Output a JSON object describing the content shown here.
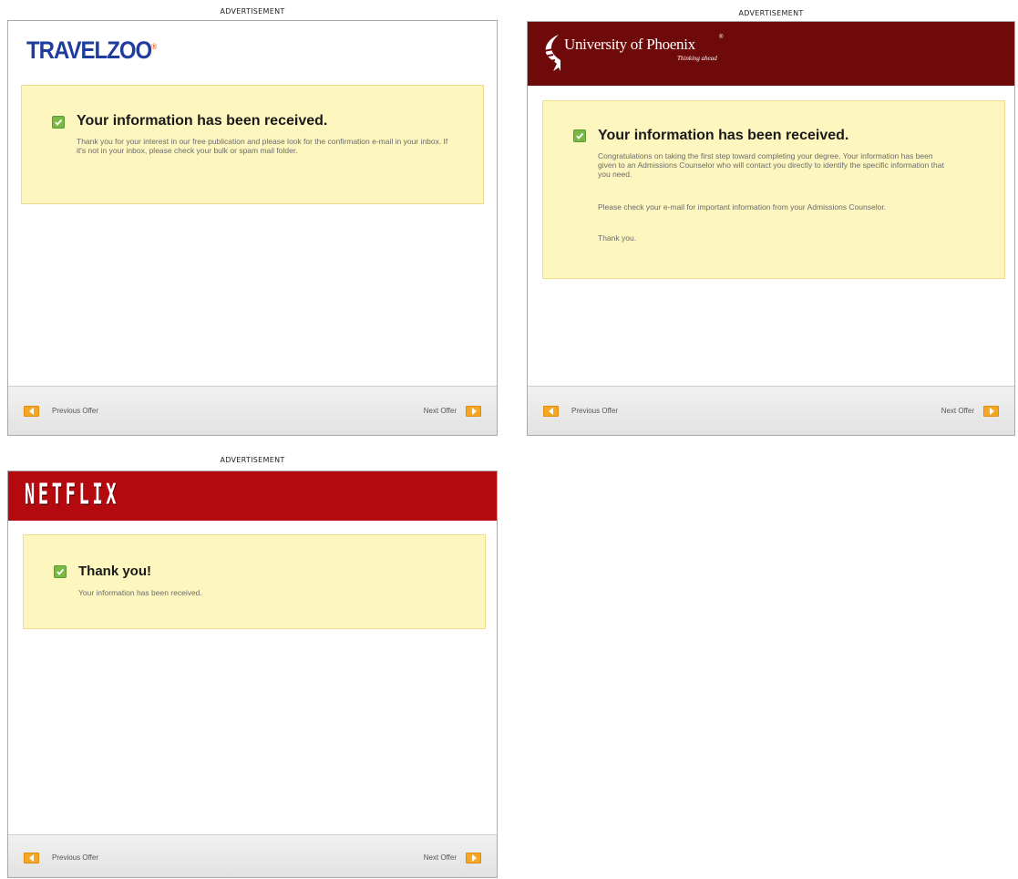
{
  "ads": {
    "travelzoo": {
      "caption": "ADVERTISEMENT",
      "brand": "TRAVELZOO",
      "brand_mark": "®",
      "heading": "Your information has been received.",
      "body": "Thank you for your interest in our free publication and please look for the confirmation e-mail in your inbox. If it's not in your inbox, please check your bulk or spam mail folder.",
      "prev_label": "Previous Offer",
      "next_label": "Next Offer"
    },
    "phoenix": {
      "caption": "ADVERTISEMENT",
      "brand": "University of Phoenix",
      "brand_mark": "®",
      "tagline": "Thinking ahead",
      "heading": "Your information has been received.",
      "body_1": "Congratulations on taking the first step toward completing your degree. Your information has been given to an Admissions Counselor who will contact you directly to identify the specific information that you need.",
      "body_2": "Please check your e-mail for important information from your Admissions Counselor.",
      "body_3": "Thank you.",
      "prev_label": "Previous Offer",
      "next_label": "Next Offer"
    },
    "netflix": {
      "caption": "ADVERTISEMENT",
      "brand": "NETFLIX",
      "heading": "Thank you!",
      "body": "Your information has been received.",
      "prev_label": "Previous Offer",
      "next_label": "Next Offer"
    }
  },
  "colors": {
    "notice_bg": "#fdf6bf",
    "notice_border": "#eddc8b",
    "check_green": "#7ab945",
    "nav_orange": "#f5a623",
    "phoenix_red": "#6e0a0a",
    "netflix_red": "#b4090f",
    "travelzoo_blue": "#1f3d9c",
    "travelzoo_orange": "#f26b21"
  },
  "icons": {
    "check": "checkbox-checked-icon",
    "prev": "arrow-left-icon",
    "next": "arrow-right-icon"
  }
}
